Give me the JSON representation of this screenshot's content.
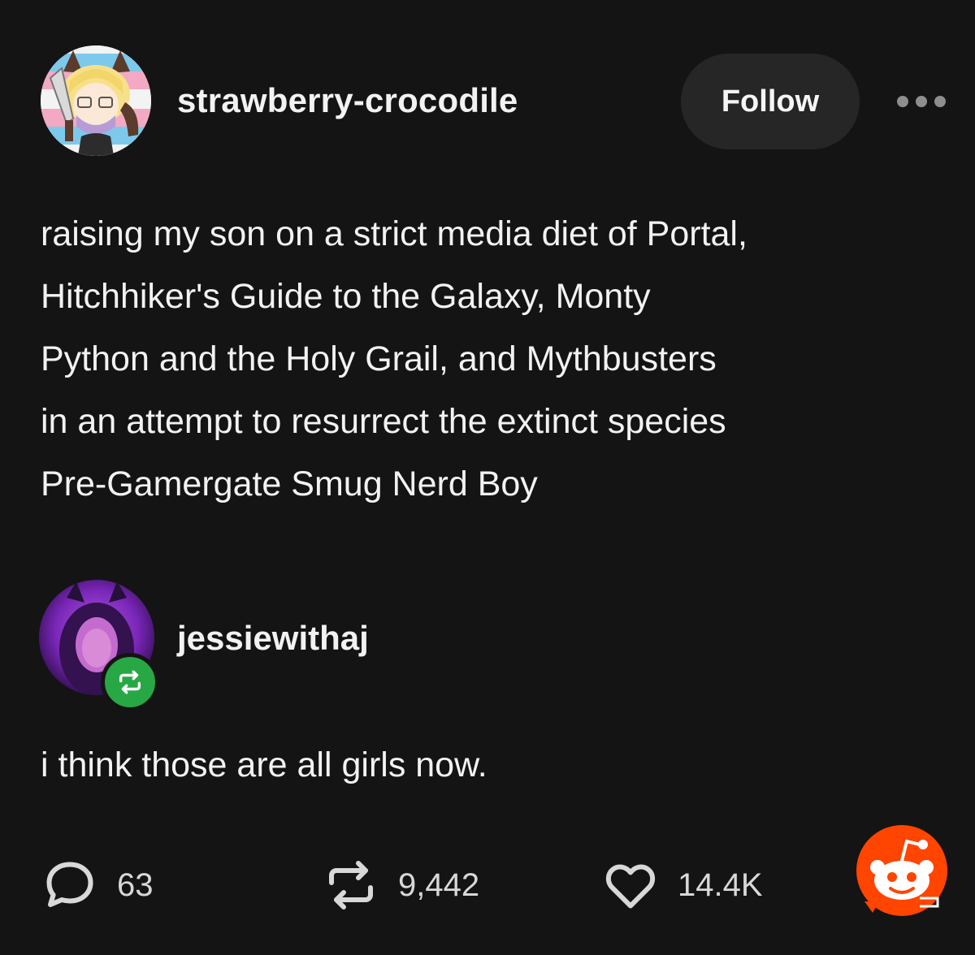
{
  "op": {
    "username": "strawberry-crocodile",
    "follow_label": "Follow",
    "text_lines": [
      "raising my son on a strict media diet of Portal,",
      "Hitchhiker's Guide to the Galaxy, Monty",
      "Python and the Holy Grail, and Mythbusters",
      "in an attempt to resurrect the extinct species",
      "Pre-Gamergate Smug Nerd Boy"
    ]
  },
  "reblog": {
    "username": "jessiewithaj",
    "text": "i think those are all girls now."
  },
  "actions": {
    "replies": "63",
    "reblogs": "9,442",
    "likes": "14.4K"
  },
  "icons": {
    "more": "more-dots-icon",
    "reblog_badge": "reblog-icon",
    "replies": "speech-bubble-icon",
    "reblogs": "reblog-icon",
    "likes": "heart-icon",
    "watermark": "reddit-logo"
  },
  "colors": {
    "background": "#141414",
    "follow_button": "#262626",
    "reblog_badge": "#27a845",
    "reddit_orange": "#ff4500"
  }
}
